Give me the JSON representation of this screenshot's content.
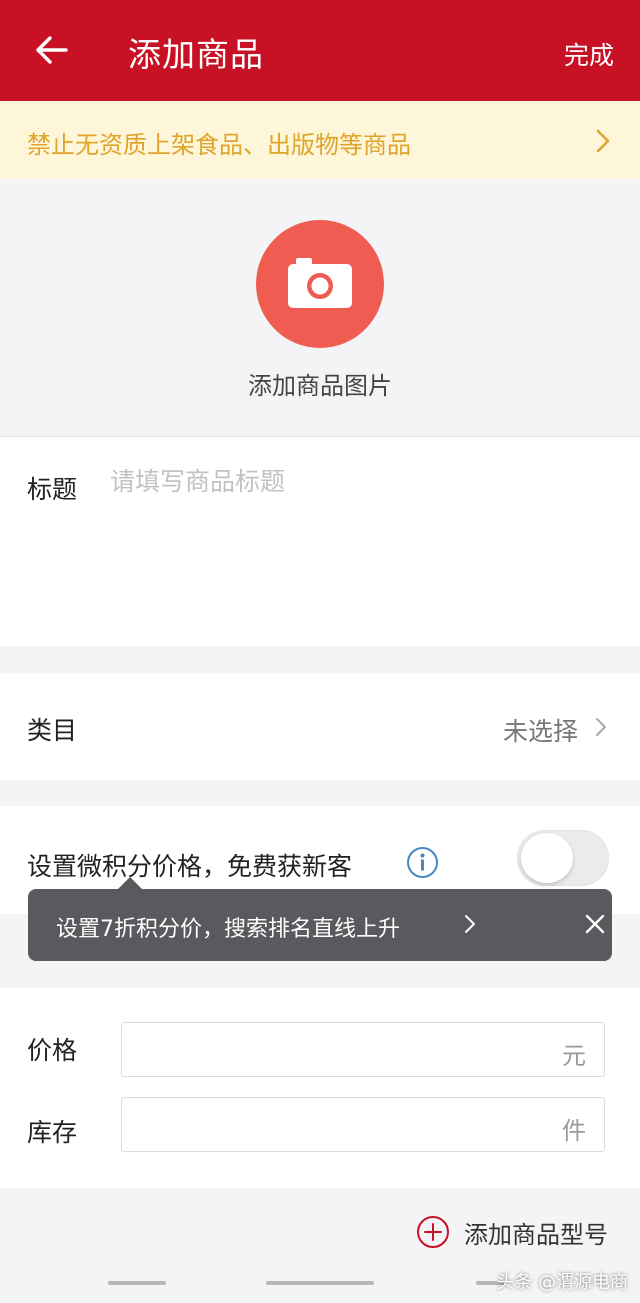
{
  "header": {
    "title": "添加商品",
    "done_label": "完成",
    "background_color": "#c81124"
  },
  "notice": {
    "text": "禁止无资质上架食品、出版物等商品",
    "text_color": "#e0a42a",
    "background_color": "#fdf6d8"
  },
  "photo": {
    "label": "添加商品图片",
    "icon": "camera-icon",
    "circle_color": "#ef5d52"
  },
  "title_field": {
    "label": "标题",
    "placeholder": "请填写商品标题",
    "value": ""
  },
  "category": {
    "label": "类目",
    "value": "未选择"
  },
  "points": {
    "label": "设置微积分价格，免费获新客",
    "toggle_on": false
  },
  "tooltip": {
    "text": "设置7折积分价，搜索排名直线上升"
  },
  "price": {
    "label": "价格",
    "unit": "元",
    "value": ""
  },
  "stock": {
    "label": "库存",
    "unit": "件",
    "value": ""
  },
  "add_model": {
    "label": "添加商品型号"
  },
  "watermark": "头条 @渭源电商"
}
